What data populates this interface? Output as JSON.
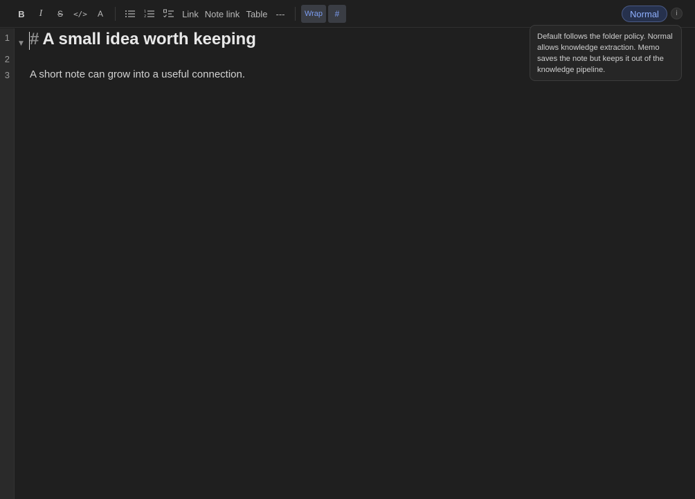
{
  "toolbar": {
    "bold": {
      "label": "B",
      "icon": "bold-icon"
    },
    "italic": {
      "label": "I",
      "icon": "italic-icon"
    },
    "strike": {
      "label": "S",
      "icon": "strikethrough-icon"
    },
    "code": {
      "label": "</>",
      "icon": "code-icon"
    },
    "font": {
      "label": "A",
      "icon": "font-icon"
    },
    "bullet_list": {
      "icon": "bullet-list-icon"
    },
    "numbered_list": {
      "icon": "numbered-list-icon"
    },
    "task_list": {
      "icon": "task-list-icon"
    },
    "link_label": "Link",
    "note_link_label": "Note link",
    "table_label": "Table",
    "hr_label": "---",
    "wrap_label": "Wrap",
    "hash_label": "#",
    "mode_label": "Normal",
    "info_label": "i"
  },
  "gutter": {
    "line_numbers": [
      "1",
      "2",
      "3"
    ]
  },
  "editor": {
    "heading_marker": "#",
    "heading_text": "A small idea worth keeping",
    "paragraph": "A short note can grow into a useful connection."
  },
  "tooltip": {
    "text": "Default follows the folder policy. Normal allows knowledge extraction. Memo saves the note but keeps it out of the knowledge pipeline."
  },
  "colors": {
    "background": "#1f1f1f",
    "accent": "#8fb0ff",
    "toggle_active_text": "#7b9cf0"
  }
}
